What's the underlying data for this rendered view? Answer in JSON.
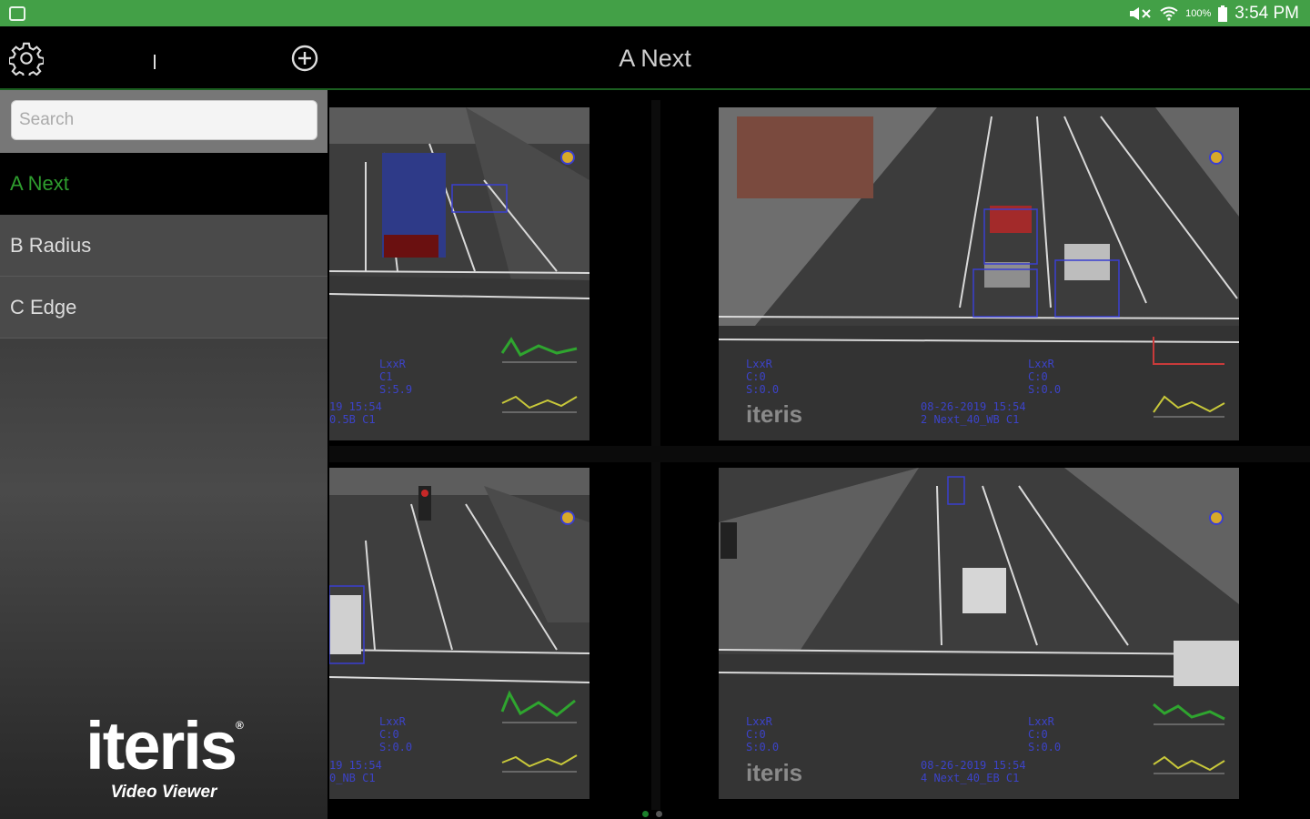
{
  "status_bar": {
    "battery_percent": "100%",
    "time": "3:54 PM",
    "icons": [
      "app-notification-icon",
      "mute-icon",
      "wifi-icon",
      "battery-icon"
    ]
  },
  "topbar": {
    "title": "A Next",
    "icons": [
      "gear-icon",
      "add-circle-icon"
    ]
  },
  "sidebar": {
    "search_placeholder": "Search",
    "items": [
      {
        "label": "A Next",
        "active": true
      },
      {
        "label": "B Radius",
        "active": false
      },
      {
        "label": "C Edge",
        "active": false
      }
    ],
    "logo": {
      "brand": "iteris",
      "sub": "Video Viewer"
    }
  },
  "cameras": [
    {
      "lines": [
        "LxxR",
        "C1",
        "S:5.9"
      ],
      "stamp": [
        "19 15:54",
        "0.5B   C1"
      ],
      "brand": ""
    },
    {
      "lines": [
        "LxxR",
        "C:0",
        "S:0.0"
      ],
      "right_lines": [
        "LxxR",
        "C:0",
        "S:0.0"
      ],
      "stamp": [
        "08-26-2019 15:54",
        "2 Next_40_WB   C1"
      ],
      "brand": "iteris"
    },
    {
      "lines": [
        "LxxR",
        "C:0",
        "S:0.0"
      ],
      "stamp": [
        "19 15:54",
        "0_NB   C1"
      ],
      "brand": ""
    },
    {
      "lines": [
        "LxxR",
        "C:0",
        "S:0.0"
      ],
      "right_lines": [
        "LxxR",
        "C:0",
        "S:0.0"
      ],
      "stamp": [
        "08-26-2019 15:54",
        "4 Next_40_EB   C1"
      ],
      "brand": "iteris"
    }
  ],
  "pagination": {
    "current": 1,
    "total": 2
  },
  "colors": {
    "accent": "#43a047",
    "active_text": "#2e9d2e",
    "overlay": "#3c43c8"
  }
}
